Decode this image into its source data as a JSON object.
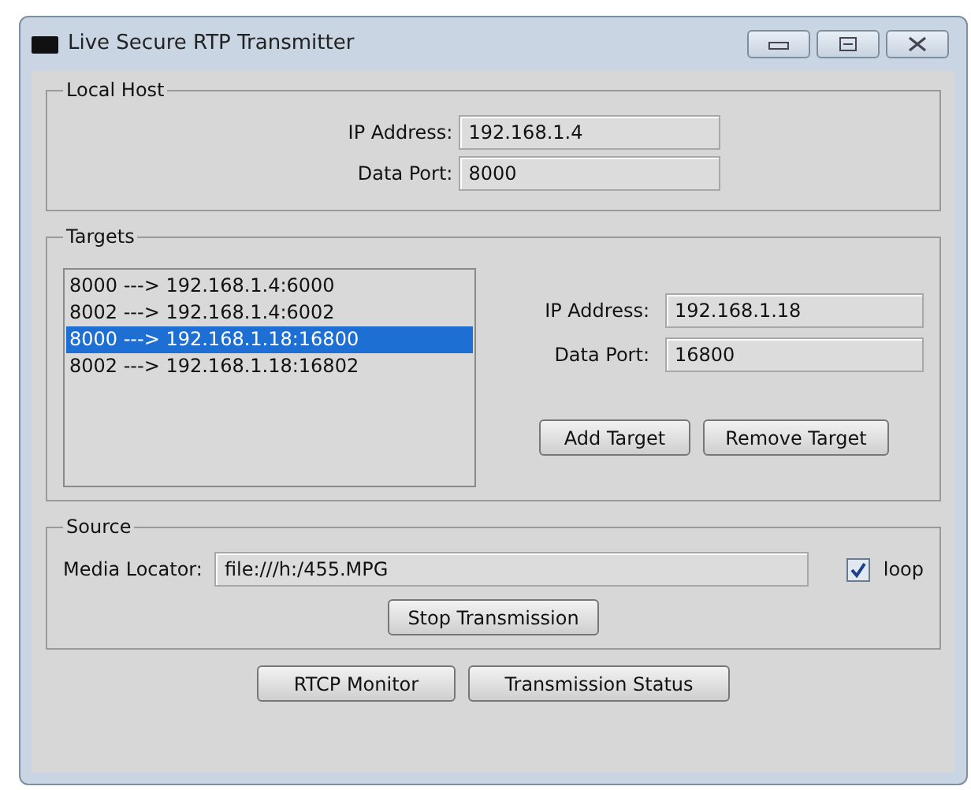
{
  "window": {
    "title": "Live Secure RTP Transmitter"
  },
  "local_host": {
    "title": "Local Host",
    "ip_label": "IP Address:",
    "ip_value": "192.168.1.4",
    "port_label": "Data Port:",
    "port_value": "8000"
  },
  "targets": {
    "title": "Targets",
    "items": [
      {
        "text": "8000 ---> 192.168.1.4:6000",
        "selected": false
      },
      {
        "text": "8002 ---> 192.168.1.4:6002",
        "selected": false
      },
      {
        "text": "8000 ---> 192.168.1.18:16800",
        "selected": true
      },
      {
        "text": "8002 ---> 192.168.1.18:16802",
        "selected": false
      }
    ],
    "ip_label": "IP Address:",
    "ip_value": "192.168.1.18",
    "port_label": "Data Port:",
    "port_value": "16800",
    "buttons": [
      "Add Target",
      "Remove Target"
    ]
  },
  "source": {
    "title": "Source",
    "locator_label": "Media Locator:",
    "locator_value": "file:///h:/455.MPG",
    "loop": {
      "label": "loop",
      "checked": true
    },
    "button": "Stop Transmission"
  },
  "buttons": [
    "RTCP Monitor",
    "Transmission Status"
  ]
}
